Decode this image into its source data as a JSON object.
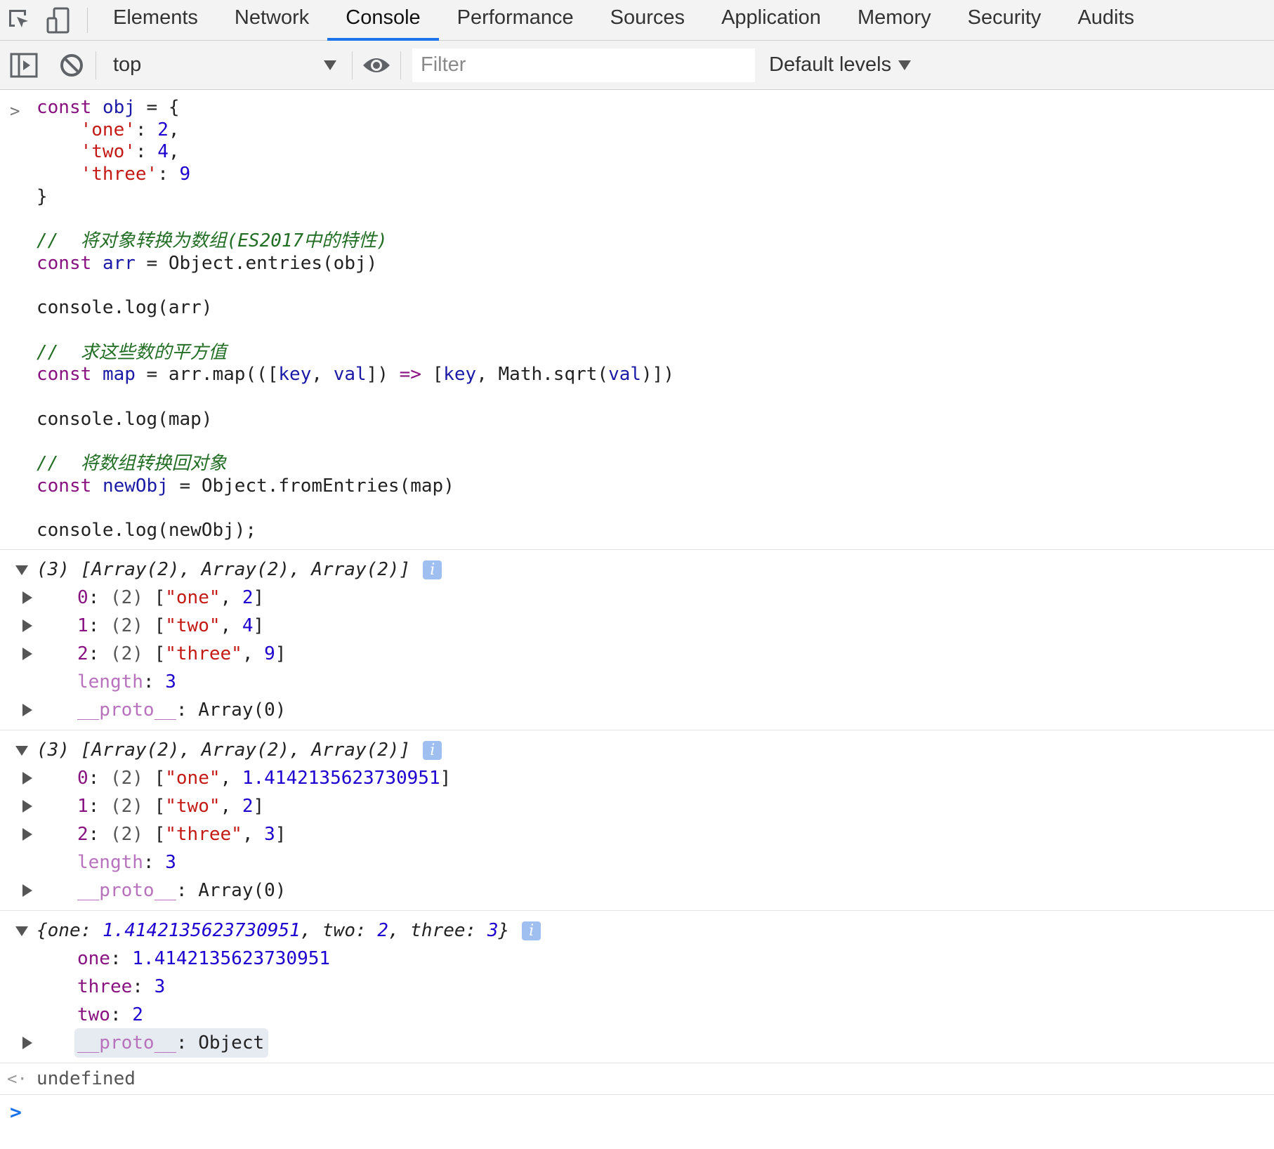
{
  "tabs": {
    "items": [
      "Elements",
      "Network",
      "Console",
      "Performance",
      "Sources",
      "Application",
      "Memory",
      "Security",
      "Audits"
    ],
    "active": "Console"
  },
  "toolbar": {
    "context": "top",
    "filter_placeholder": "Filter",
    "levels": "Default levels"
  },
  "input_code": {
    "obj_decl": "obj",
    "obj_keys": [
      "'one'",
      "'two'",
      "'three'"
    ],
    "obj_values": [
      "2",
      "4",
      "9"
    ],
    "comment1": "//  将对象转换为数组(ES2017中的特性)",
    "arr_decl": "arr",
    "arr_expr": "Object.entries(obj)",
    "log1": "console.log(arr)",
    "comment2": "//  求这些数的平方值",
    "map_decl": "map",
    "log2": "console.log(map)",
    "comment3": "//  将数组转换回对象",
    "newobj_decl": "newObj",
    "newobj_expr": "Object.fromEntries(map)",
    "log3": "console.log(newObj);"
  },
  "output1": {
    "summary": "(3) [Array(2), Array(2), Array(2)]",
    "items": [
      {
        "index": "0",
        "count": "(2)",
        "key": "\"one\"",
        "value": "2"
      },
      {
        "index": "1",
        "count": "(2)",
        "key": "\"two\"",
        "value": "4"
      },
      {
        "index": "2",
        "count": "(2)",
        "key": "\"three\"",
        "value": "9"
      }
    ],
    "length_label": "length",
    "length_value": "3",
    "proto_label": "__proto__",
    "proto_value": "Array(0)"
  },
  "output2": {
    "summary": "(3) [Array(2), Array(2), Array(2)]",
    "items": [
      {
        "index": "0",
        "count": "(2)",
        "key": "\"one\"",
        "value": "1.4142135623730951"
      },
      {
        "index": "1",
        "count": "(2)",
        "key": "\"two\"",
        "value": "2"
      },
      {
        "index": "2",
        "count": "(2)",
        "key": "\"three\"",
        "value": "3"
      }
    ],
    "length_label": "length",
    "length_value": "3",
    "proto_label": "__proto__",
    "proto_value": "Array(0)"
  },
  "output3": {
    "summary_keys": [
      "one",
      "two",
      "three"
    ],
    "summary_values": [
      "1.4142135623730951",
      "2",
      "3"
    ],
    "props": [
      {
        "key": "one",
        "value": "1.4142135623730951"
      },
      {
        "key": "three",
        "value": "3"
      },
      {
        "key": "two",
        "value": "2"
      }
    ],
    "proto_label": "__proto__",
    "proto_value": "Object"
  },
  "result_text": "undefined",
  "colors": {
    "accent": "#1a73e8",
    "keyword": "#881280",
    "string": "#c41a16",
    "number": "#1c00cf",
    "comment": "#236e25",
    "variable": "#1a1aa6"
  },
  "icons": [
    "inspect-element-icon",
    "device-toggle-icon",
    "sidebar-toggle-icon",
    "clear-console-icon",
    "eye-icon",
    "info-icon"
  ]
}
